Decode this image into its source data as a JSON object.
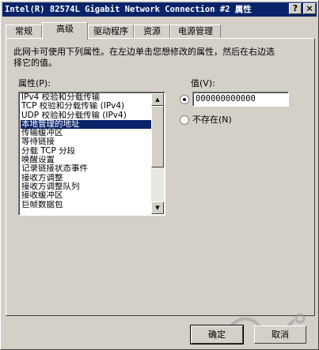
{
  "window": {
    "title": "Intel(R) 82574L Gigabit Network Connection #2 属性"
  },
  "title_buttons": {
    "help": "?",
    "close": "×"
  },
  "tabs": [
    {
      "label": "常规"
    },
    {
      "label": "高级"
    },
    {
      "label": "驱动程序"
    },
    {
      "label": "资源"
    },
    {
      "label": "电源管理"
    }
  ],
  "panel": {
    "description": "此网卡可使用下列属性。在左边单击您想修改的属性，然后在右边选择它的值。",
    "property_label": "属性(P):",
    "value_label": "值(V):",
    "properties": [
      "IPv4 校验和分载传输",
      "TCP 校验和分载传输 (IPv4)",
      "UDP 校验和分载传输 (IPv4)",
      "本地管理的地址",
      "传输缓冲区",
      "等待链接",
      "分载 TCP 分段",
      "唤醒设置",
      "记录链接状态事件",
      "接收方调整",
      "接收方调整队列",
      "接收缓冲区",
      "巨帧数据包"
    ],
    "selected_index": 3,
    "value": "000000000000",
    "not_present_label": "不存在(N)"
  },
  "buttons": {
    "ok": "确定",
    "cancel": "取消"
  },
  "colors": {
    "titlebar": "#0a246a",
    "face": "#d4d0c8",
    "selection": "#0a246a"
  }
}
